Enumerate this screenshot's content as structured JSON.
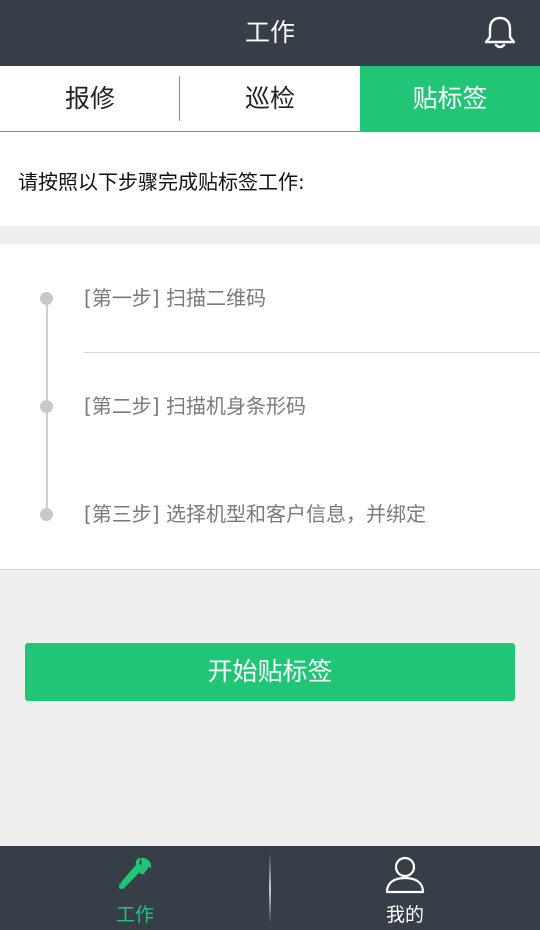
{
  "header": {
    "title": "工作",
    "bell_icon": "bell-icon"
  },
  "tabs": [
    {
      "label": "报修",
      "active": false
    },
    {
      "label": "巡检",
      "active": false
    },
    {
      "label": "贴标签",
      "active": true
    }
  ],
  "intro": {
    "text": "请按照以下步骤完成贴标签工作:"
  },
  "steps": [
    {
      "text": "[第一步] 扫描二维码"
    },
    {
      "text": "[第二步] 扫描机身条形码"
    },
    {
      "text": "[第三步] 选择机型和客户信息，并绑定"
    }
  ],
  "start_button": {
    "label": "开始贴标签"
  },
  "bottom_nav": [
    {
      "label": "工作",
      "icon": "wrench-icon",
      "active": true
    },
    {
      "label": "我的",
      "icon": "user-icon",
      "active": false
    }
  ],
  "colors": {
    "accent": "#20c575",
    "dark_bar": "#363e47",
    "background": "#efefef"
  }
}
